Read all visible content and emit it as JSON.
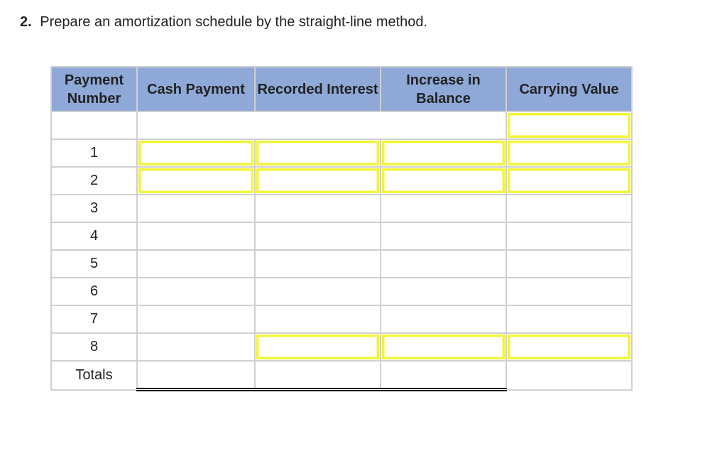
{
  "question": {
    "number": "2.",
    "text": "Prepare an amortization schedule by the straight-line method."
  },
  "table": {
    "headers": [
      "Payment Number",
      "Cash Payment",
      "Recorded Interest",
      "Increase in Balance",
      "Carrying Value"
    ],
    "header_bg": "#8ea8d7",
    "input_border_color": "#f3f33a",
    "rows": [
      {
        "label": "",
        "cash_payment": "",
        "recorded_interest": "",
        "increase_in_balance": "",
        "carrying_value": ""
      },
      {
        "label": "1",
        "cash_payment": "",
        "recorded_interest": "",
        "increase_in_balance": "",
        "carrying_value": ""
      },
      {
        "label": "2",
        "cash_payment": "",
        "recorded_interest": "",
        "increase_in_balance": "",
        "carrying_value": ""
      },
      {
        "label": "3"
      },
      {
        "label": "4"
      },
      {
        "label": "5"
      },
      {
        "label": "6"
      },
      {
        "label": "7"
      },
      {
        "label": "8",
        "recorded_interest": "",
        "increase_in_balance": "",
        "carrying_value": ""
      },
      {
        "label": "Totals"
      }
    ]
  }
}
